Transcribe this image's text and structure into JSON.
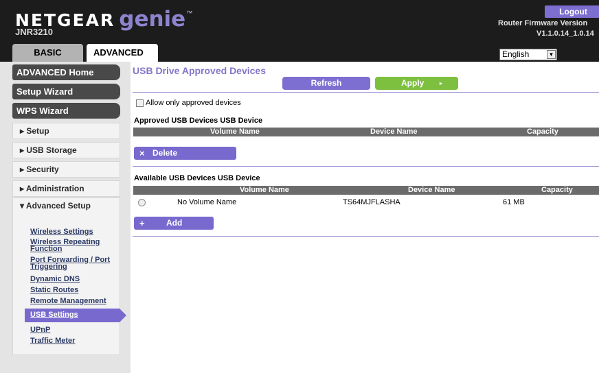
{
  "header": {
    "brand": "NETGEAR",
    "product": "genie",
    "trademark": "™",
    "model": "JNR3210",
    "logout_label": "Logout",
    "firmware_label": "Router Firmware Version",
    "firmware_version": "V1.1.0.14_1.0.14",
    "tabs": [
      {
        "label": "BASIC",
        "active": false
      },
      {
        "label": "ADVANCED",
        "active": true
      }
    ],
    "language": "English"
  },
  "sidebar": {
    "primary": [
      {
        "label": "ADVANCED Home"
      },
      {
        "label": "Setup Wizard"
      },
      {
        "label": "WPS Wizard"
      }
    ],
    "sections": [
      {
        "label": "▸ Setup"
      },
      {
        "label": "▸ USB Storage"
      },
      {
        "label": "▸ Security"
      },
      {
        "label": "▸ Administration"
      }
    ],
    "open_section": {
      "label": "▾ Advanced Setup",
      "links": [
        "Wireless Settings",
        "Wireless Repeating Function",
        "Port Forwarding / Port Triggering",
        "Dynamic DNS",
        "Static Routes",
        "Remote Management",
        "USB Settings",
        "UPnP",
        "Traffic Meter"
      ],
      "active_link": "USB Settings"
    }
  },
  "main": {
    "title": "USB Drive Approved Devices",
    "refresh_label": "Refresh",
    "apply_label": "Apply",
    "apply_arrow": "▸",
    "allow_only_label": "Allow only approved devices",
    "allow_only_checked": false,
    "approved": {
      "title": "Approved USB Devices USB Device",
      "columns": [
        "Volume Name",
        "Device Name",
        "Capacity"
      ],
      "rows": [],
      "delete_label": "Delete",
      "delete_icon": "×"
    },
    "available": {
      "title": "Available USB Devices USB Device",
      "columns": [
        "Volume Name",
        "Device Name",
        "Capacity"
      ],
      "rows": [
        {
          "volume": "No Volume Name",
          "device": "TS64MJFLASHA",
          "capacity": "61 MB",
          "selected": false
        }
      ],
      "add_label": "Add",
      "add_icon": "+"
    }
  },
  "colors": {
    "accent": "#7d6fd1",
    "apply_green": "#7dbf3f",
    "header_bg": "#1c1c1c",
    "table_header": "#6b6b6b"
  }
}
